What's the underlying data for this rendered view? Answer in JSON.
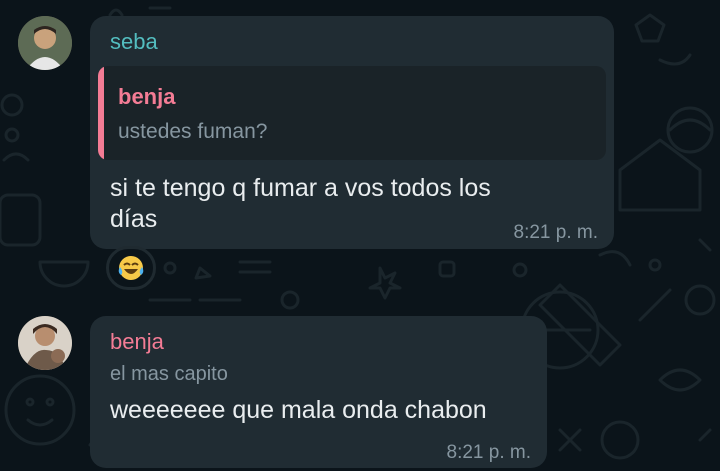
{
  "colors": {
    "background": "#0b141a",
    "bubble": "#202c33",
    "quote_bg": "#1a2328",
    "seba": "#53bdbf",
    "benja": "#f47c95",
    "text": "#e9edef",
    "meta": "#8696a0"
  },
  "messages": [
    {
      "sender": "seba",
      "sender_color": "#53bdbf",
      "reply": {
        "author": "benja",
        "text": "ustedes fuman?"
      },
      "text_line1": "si te tengo q fumar a vos todos los",
      "text_line2": "días",
      "time": "8:21 p. m.",
      "reaction": "😂",
      "avatar_icon": "user-avatar-icon"
    },
    {
      "sender": "benja",
      "sender_color": "#f47c95",
      "subtitle": "el mas capito",
      "text": "weeeeeee que mala onda chabon",
      "time": "8:21 p. m.",
      "avatar_icon": "user-avatar-icon"
    }
  ]
}
